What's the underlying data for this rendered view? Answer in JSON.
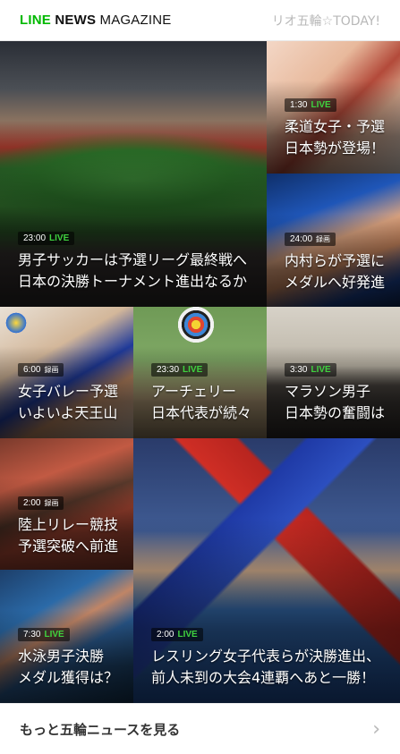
{
  "header": {
    "brand_line": "LINE",
    "brand_news": "NEWS",
    "brand_magazine": "MAGAZINE",
    "section": "リオ五輪☆TODAY!"
  },
  "tiles": {
    "football": {
      "time": "23:00",
      "badge": "LIVE",
      "title": "男子サッカーは予選リーグ最終戦へ\n日本の決勝トーナメント進出なるか"
    },
    "judo": {
      "time": "1:30",
      "badge": "LIVE",
      "title": "柔道女子・予選\n日本勢が登場！"
    },
    "gymnastics": {
      "time": "24:00",
      "badge": "録画",
      "title": "内村らが予選に\nメダルへ好発進"
    },
    "volleyball": {
      "time": "6:00",
      "badge": "録画",
      "title": "女子バレー予選\nいよいよ天王山"
    },
    "archery": {
      "time": "23:30",
      "badge": "LIVE",
      "title": "アーチェリー\n日本代表が続々"
    },
    "marathon": {
      "time": "3:30",
      "badge": "LIVE",
      "title": "マラソン男子\n日本勢の奮闘は"
    },
    "relay": {
      "time": "2:00",
      "badge": "録画",
      "title": "陸上リレー競技\n予選突破へ前進"
    },
    "swimming": {
      "time": "7:30",
      "badge": "LIVE",
      "title": "水泳男子決勝\nメダル獲得は？"
    },
    "wrestling": {
      "time": "2:00",
      "badge": "LIVE",
      "title": "レスリング女子代表らが決勝進出、\n前人未到の大会4連覇へあと一勝！"
    }
  },
  "footer": {
    "label": "もっと五輪ニュースを見る",
    "chevron_icon": "chevron-right-icon"
  }
}
